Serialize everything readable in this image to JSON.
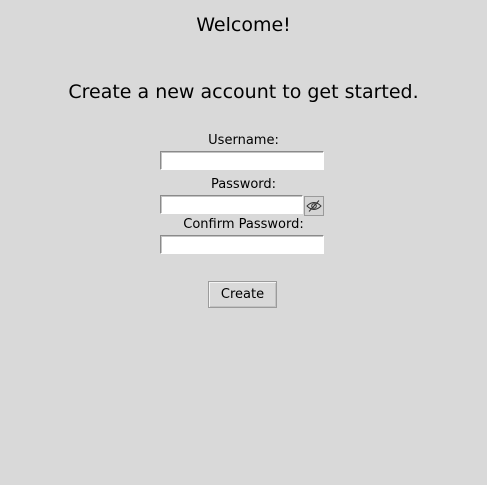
{
  "heading": "Welcome!",
  "subheading": "Create a new account to get started.",
  "form": {
    "username_label": "Username:",
    "username_value": "",
    "password_label": "Password:",
    "password_value": "",
    "password_toggle_icon": "eye-slash-icon",
    "confirm_label": "Confirm Password:",
    "confirm_value": ""
  },
  "actions": {
    "create_label": "Create"
  }
}
